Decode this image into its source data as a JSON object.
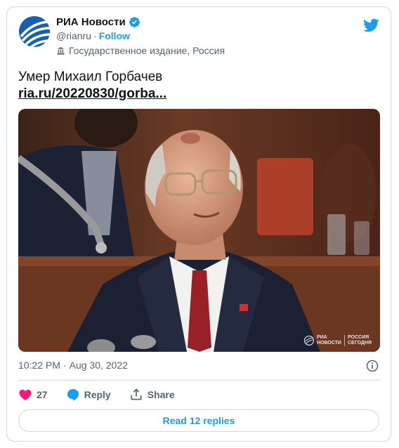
{
  "account": {
    "name": "РИА Новости",
    "handle": "@rianru",
    "separator": "·",
    "follow_label": "Follow",
    "label": "Государственное издание, Россия"
  },
  "tweet": {
    "text": "Умер Михаил Горбачев",
    "link_text": "ria.ru/20220830/gorba...",
    "time": "10:22 PM",
    "separator": "·",
    "date": "Aug 30, 2022"
  },
  "photo": {
    "watermark_logo_line1": "РИА",
    "watermark_logo_line2": "НОВОСТИ",
    "watermark_right_line1": "РОССИЯ",
    "watermark_right_line2": "СЕГОДНЯ"
  },
  "actions": {
    "like_count": "27",
    "reply_label": "Reply",
    "share_label": "Share",
    "read_replies_label": "Read 12 replies"
  },
  "icons": {
    "avatar": "ria-globe-logo",
    "verified": "verified-badge-icon",
    "label": "government-building-icon",
    "brand": "twitter-bird-icon",
    "info": "info-icon",
    "like": "heart-icon",
    "reply": "speech-bubble-icon",
    "share": "share-icon"
  },
  "colors": {
    "accent": "#1d9bf0",
    "like": "#f91880",
    "text": "#0f1419",
    "secondary": "#536471",
    "border": "#cfd9de"
  }
}
